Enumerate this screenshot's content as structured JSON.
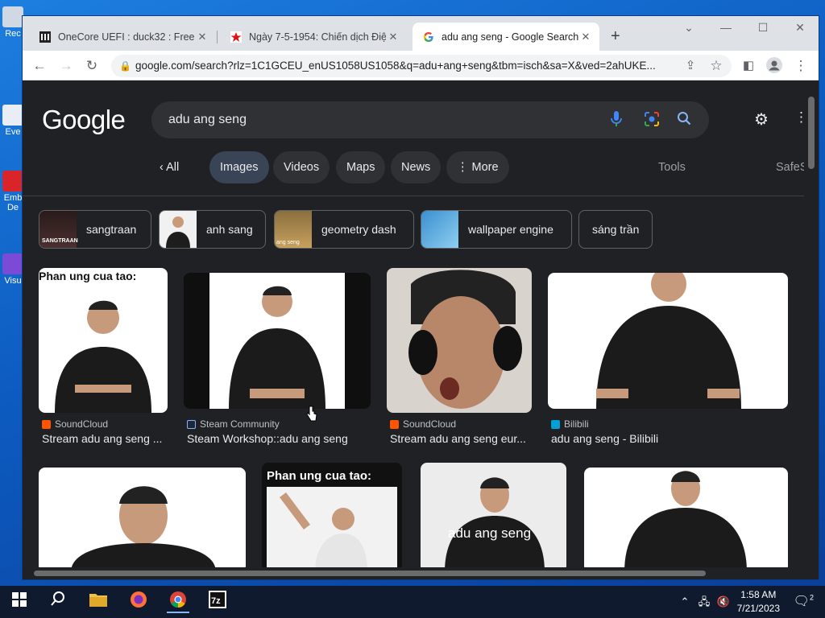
{
  "desktop": {
    "icons": [
      {
        "label": "Rec"
      },
      {
        "label": "Eve"
      },
      {
        "label": "Emb De"
      },
      {
        "label": "Visu"
      }
    ]
  },
  "browser": {
    "tabs": [
      {
        "title": "OneCore UEFI : duck32 : Free Do",
        "favicon": "archive-icon"
      },
      {
        "title": "Ngày 7-5-1954: Chiến dịch Điện",
        "favicon": "star-flag-icon"
      },
      {
        "title": "adu ang seng - Google Search",
        "favicon": "google-g-icon"
      }
    ],
    "url": "google.com/search?rlz=1C1GCEU_enUS1058US1058&q=adu+ang+seng&tbm=isch&sa=X&ved=2ahUKE..."
  },
  "google": {
    "logo": "Google",
    "query": "adu ang seng",
    "filters": {
      "all": "All",
      "images": "Images",
      "videos": "Videos",
      "maps": "Maps",
      "news": "News",
      "more": "More",
      "tools": "Tools",
      "safesearch": "SafeS"
    },
    "related": [
      "sangtraan",
      "anh sang",
      "geometry dash",
      "wallpaper engine",
      "sáng trần"
    ],
    "related_thumb_text": [
      "SANGTRAAN",
      "ang seng"
    ],
    "results_row1": [
      {
        "source": "SoundCloud",
        "title": "Stream adu ang seng ...",
        "caption": "Phan ung cua tao:"
      },
      {
        "source": "Steam Community",
        "title": "Steam Workshop::adu ang seng"
      },
      {
        "source": "SoundCloud",
        "title": "Stream adu ang seng eur..."
      },
      {
        "source": "Bilibili",
        "title": "adu ang seng - Bilibili"
      }
    ],
    "results_row2": [
      {
        "caption": ""
      },
      {
        "caption": "Phan ung cua tao:"
      },
      {
        "caption": "adu ang seng"
      },
      {
        "caption": ""
      }
    ]
  },
  "taskbar": {
    "time": "1:58 AM",
    "date": "7/21/2023",
    "notifications": "2"
  }
}
